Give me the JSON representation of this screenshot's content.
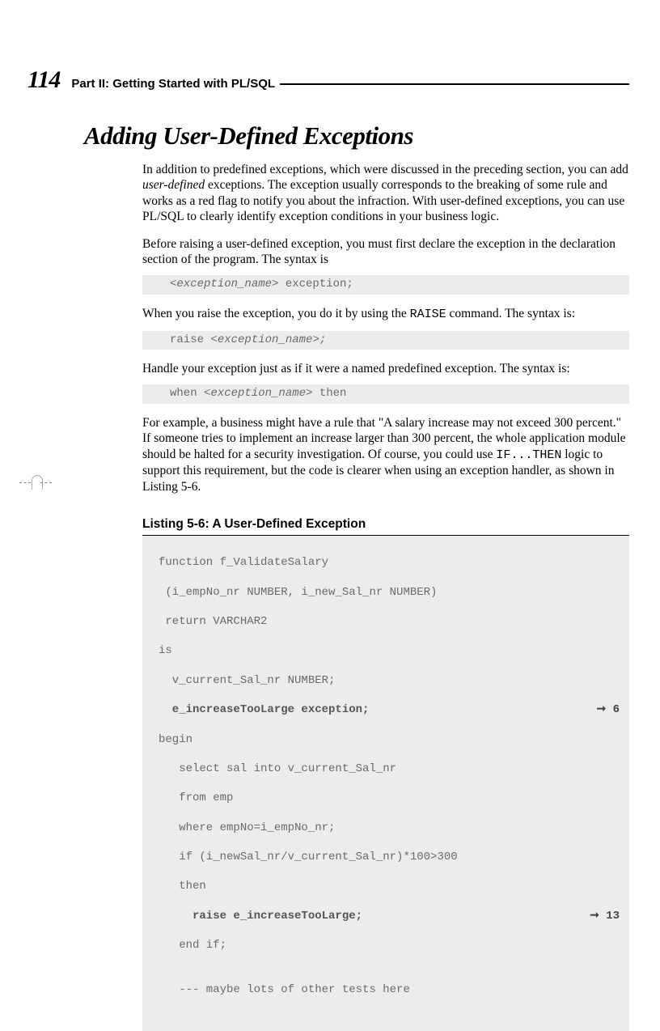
{
  "header": {
    "page_number": "114",
    "part_title": "Part II: Getting Started with PL/SQL"
  },
  "heading": "Adding User-Defined Exceptions",
  "paragraphs": {
    "p1_a": "In addition to predefined exceptions, which were discussed in the preceding section, you can add ",
    "p1_b": "user-defined",
    "p1_c": " exceptions. The exception usually corresponds to the breaking of some rule and works as a red flag to notify you about the infraction. With user-defined exceptions, you can use PL/SQL to clearly identify exception conditions in your business logic.",
    "p2": "Before raising a user-defined exception, you must first declare the exception in the declaration section of the program. The syntax is",
    "p3_a": "When you raise the exception, you do it by using the ",
    "p3_b": "RAISE",
    "p3_c": " command. The syntax is:",
    "p4": "Handle your exception just as if it were a named predefined exception. The syntax is:",
    "p5_a": "For example, a business might have a rule that \"A salary increase may not exceed 300 percent.\" If someone tries to implement an increase larger than 300 percent, the whole application module should be halted for a security investigation. Of course, you could use ",
    "p5_b": "IF...THEN",
    "p5_c": " logic to support this requirement, but the code is clearer when using an exception handler, as shown in Listing 5-6."
  },
  "code_snips": {
    "s1_a": "<exception_name>",
    "s1_b": " exception;",
    "s2_a": "raise ",
    "s2_b": "<exception_name>;",
    "s3_a": "when ",
    "s3_b": "<exception_name>",
    "s3_c": " then"
  },
  "listing": {
    "title": "Listing 5-6:   A User-Defined Exception",
    "lines": {
      "l1": "function f_ValidateSalary",
      "l2": " (i_empNo_nr NUMBER, i_new_Sal_nr NUMBER)",
      "l3": " return VARCHAR2",
      "l4": "is",
      "l5": "  v_current_Sal_nr NUMBER;",
      "l6": "  e_increaseTooLarge exception;",
      "l7": "begin",
      "l8": "   select sal into v_current_Sal_nr",
      "l9": "   from emp",
      "l10": "   where empNo=i_empNo_nr;",
      "l11": "   if (i_newSal_nr/v_current_Sal_nr)*100>300",
      "l12": "   then",
      "l13": "     raise e_increaseTooLarge;",
      "l14": "   end if;",
      "l15": "",
      "l16": "   --- maybe lots of other tests here"
    },
    "annotations": {
      "a6": "➞ 6",
      "a13": "➞ 13"
    }
  }
}
